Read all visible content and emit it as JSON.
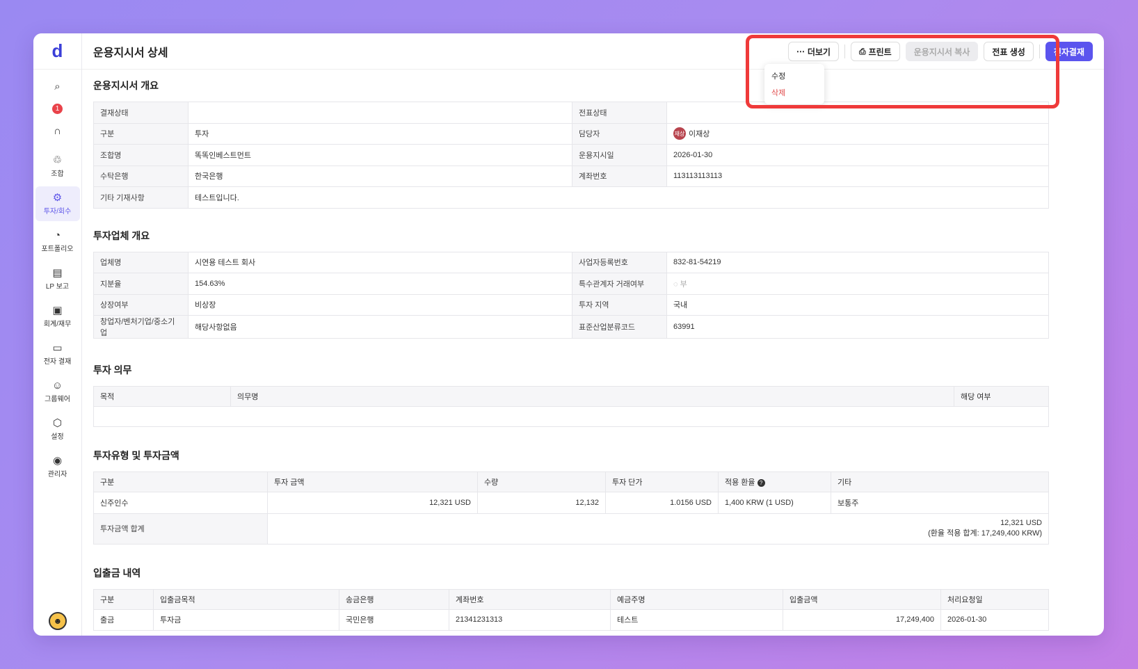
{
  "sidebar": {
    "logo": "d",
    "notification_count": "1",
    "items": [
      {
        "label": "조합",
        "icon": "union-icon"
      },
      {
        "label": "투자/회수",
        "icon": "invest-icon"
      },
      {
        "label": "포트폴리오",
        "icon": "portfolio-icon"
      },
      {
        "label": "LP 보고",
        "icon": "report-icon"
      },
      {
        "label": "회계/재무",
        "icon": "accounting-icon"
      },
      {
        "label": "전자 결재",
        "icon": "approval-icon"
      },
      {
        "label": "그룹웨어",
        "icon": "groupware-icon"
      },
      {
        "label": "설정",
        "icon": "settings-icon"
      },
      {
        "label": "관리자",
        "icon": "admin-icon"
      }
    ]
  },
  "header": {
    "title": "운용지시서 상세",
    "more_label": "더보기",
    "print_label": "프린트",
    "copy_label": "운용지시서 복사",
    "voucher_label": "전표 생성",
    "approval_label": "전자결재"
  },
  "dropdown": {
    "edit": "수정",
    "delete": "삭제"
  },
  "overview": {
    "title": "운용지시서 개요",
    "rows": [
      {
        "l1": "결재상태",
        "v1": "",
        "l2": "전표상태",
        "v2": ""
      },
      {
        "l1": "구분",
        "v1": "투자",
        "l2": "담당자",
        "v2": "이재상"
      },
      {
        "l1": "조합명",
        "v1": "똑똑인베스트먼트",
        "l2": "운용지시일",
        "v2": "2026-01-30"
      },
      {
        "l1": "수탁은행",
        "v1": "한국은행",
        "l2": "계좌번호",
        "v2": "113113113113"
      }
    ],
    "memo_label": "기타 기재사항",
    "memo_value": "테스트입니다.",
    "manager_badge": "재상"
  },
  "company": {
    "title": "투자업체 개요",
    "rows": [
      {
        "l1": "업체명",
        "v1": "시연용 테스트 회사",
        "l2": "사업자등록번호",
        "v2": "832-81-54219"
      },
      {
        "l1": "지분율",
        "v1": "154.63%",
        "l2": "특수관계자 거래여부",
        "v2": "부"
      },
      {
        "l1": "상장여부",
        "v1": "비상장",
        "l2": "투자 지역",
        "v2": "국내"
      },
      {
        "l1": "창업자/벤처기업/중소기업",
        "v1": "해당사항없음",
        "l2": "표준산업분류코드",
        "v2": "63991"
      }
    ]
  },
  "duty": {
    "title": "투자 의무",
    "headers": [
      "목적",
      "의무명",
      "해당 여부"
    ]
  },
  "investment": {
    "title": "투자유형 및 투자금액",
    "headers": [
      "구분",
      "투자 금액",
      "수량",
      "투자 단가",
      "적용 환율",
      "기타"
    ],
    "row": [
      "신주인수",
      "12,321 USD",
      "12,132",
      "1.0156 USD",
      "1,400 KRW (1 USD)",
      "보통주"
    ],
    "total_label": "투자금액 합계",
    "total_value": "12,321 USD",
    "total_krw": "(환율 적용 합계: 17,249,400 KRW)"
  },
  "cashflow": {
    "title": "입출금 내역",
    "headers": [
      "구분",
      "입출금목적",
      "송금은행",
      "계좌번호",
      "예금주명",
      "입출금액",
      "처리요청일"
    ],
    "row": [
      "출금",
      "투자금",
      "국민은행",
      "21341231313",
      "테스트",
      "17,249,400",
      "2026-01-30"
    ]
  }
}
